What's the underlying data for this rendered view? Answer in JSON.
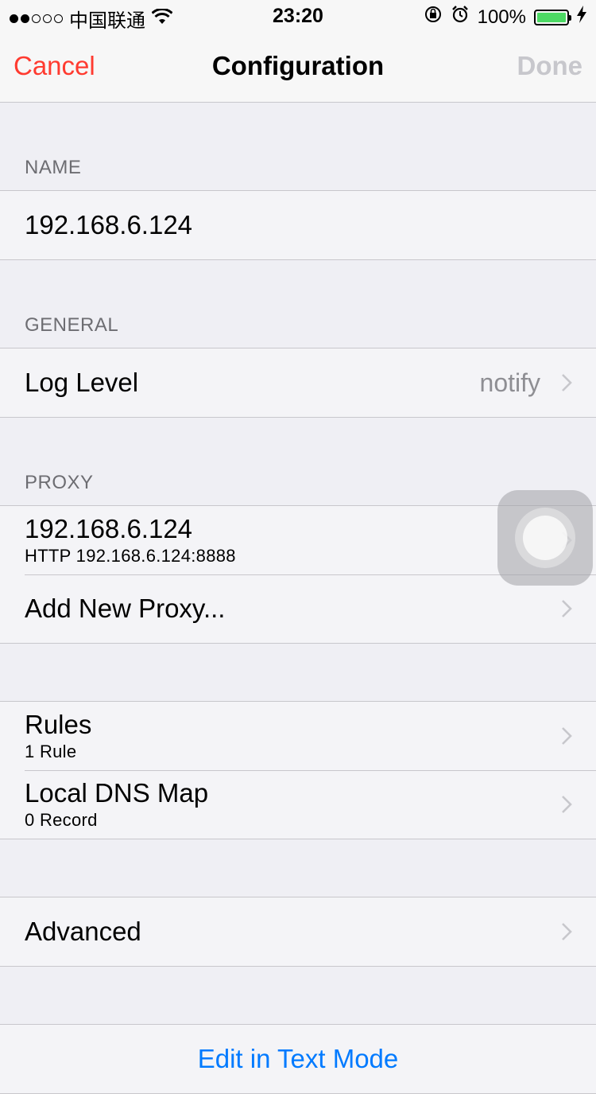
{
  "status_bar": {
    "carrier": "中国联通",
    "time": "23:20",
    "battery_percent": "100%",
    "signal_bars_filled": 2,
    "signal_bars_total": 5,
    "battery_level": 1.0,
    "icons": [
      "wifi-icon",
      "rotation-lock-icon",
      "alarm-icon",
      "battery-icon",
      "charging-bolt-icon"
    ]
  },
  "nav": {
    "cancel_label": "Cancel",
    "title": "Configuration",
    "done_label": "Done"
  },
  "sections": {
    "name": {
      "header": "NAME",
      "value": "192.168.6.124"
    },
    "general": {
      "header": "GENERAL",
      "log_level_label": "Log Level",
      "log_level_value": "notify"
    },
    "proxy": {
      "header": "PROXY",
      "items": [
        {
          "title": "192.168.6.124",
          "subtitle": "HTTP 192.168.6.124:8888"
        }
      ],
      "add_label": "Add New Proxy..."
    },
    "rules": {
      "items": [
        {
          "title": "Rules",
          "subtitle": "1 Rule"
        },
        {
          "title": "Local DNS Map",
          "subtitle": "0 Record"
        }
      ]
    },
    "advanced": {
      "label": "Advanced"
    },
    "footer": {
      "edit_text_mode": "Edit in Text Mode"
    }
  },
  "colors": {
    "accent_red": "#ff3b30",
    "accent_blue": "#007aff",
    "disabled": "#c7c7cc",
    "background": "#efeff4"
  }
}
